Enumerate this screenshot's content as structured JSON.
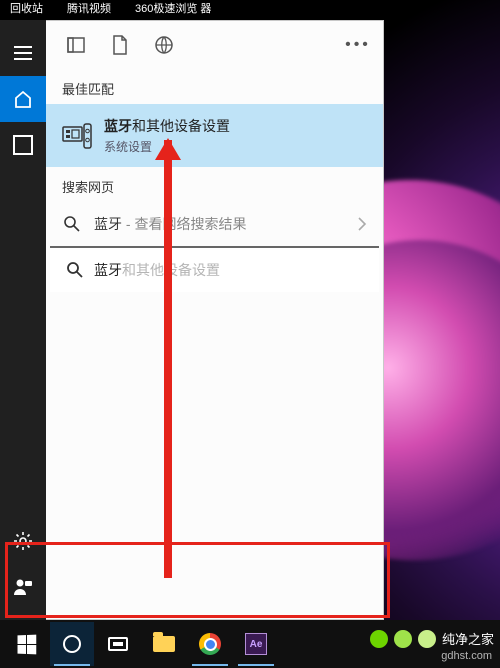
{
  "desktop_icons": {
    "recycle": "回收站",
    "tencent": "腾讯视频",
    "browser360": "360极速浏览\n器"
  },
  "panel": {
    "best_match_label": "最佳匹配",
    "best": {
      "title_em": "蓝牙",
      "title_rest": "和其他设备设置",
      "subtitle": "系统设置"
    },
    "web_label": "搜索网页",
    "web_item": {
      "term": "蓝牙",
      "suffix": " - 查看网络搜索结果"
    }
  },
  "search": {
    "typed": "蓝牙",
    "ghost": "和其他设备设置"
  },
  "ae_label": "Ae",
  "watermark": {
    "brand": "纯净之家",
    "url": "gdhst.com"
  }
}
